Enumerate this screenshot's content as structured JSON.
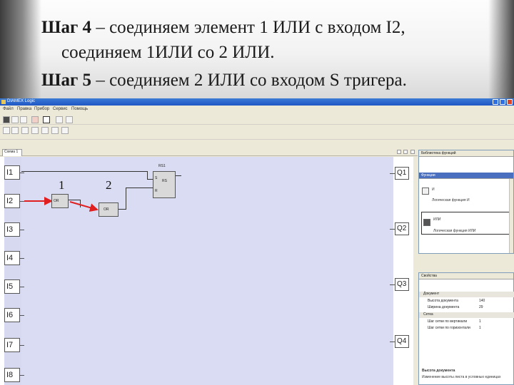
{
  "slide": {
    "line1_bold": "Шаг 4",
    "line1_text": " – соединяем элемент 1 ИЛИ с входом I2,",
    "line2_text": "соединяем 1ИЛИ со 2 ИЛИ.",
    "line3_bold": "Шаг 5",
    "line3_text": " – соединяем 2 ИЛИ со входом S тригера."
  },
  "app": {
    "title": "DIAMEX Logic",
    "menu": [
      "Файл",
      "Правка",
      "Прибор",
      "Сервис",
      "Помощь"
    ],
    "tab_label": "Схема 1",
    "inputs": [
      "I1",
      "I2",
      "I3",
      "I4",
      "I5",
      "I6",
      "I7",
      "I8"
    ],
    "outputs": [
      "Q1",
      "Q2",
      "Q3",
      "Q4"
    ],
    "blocks": {
      "or1_label": "OR",
      "or2_label": "OR",
      "trigger_label": "RS",
      "trigger_tag": "RS1",
      "trigger_pin_s": "S",
      "trigger_pin_r": "R",
      "num1": "1",
      "num2": "2"
    },
    "panels": {
      "library": {
        "title": "Библиотека функций",
        "header": "Функции",
        "item1_name": "И",
        "item1_desc": "Логическая функция И",
        "item2_name": "ИЛИ",
        "item2_desc": "Логическая функция ИЛИ"
      },
      "properties": {
        "title": "Свойства",
        "cat1": "Документ",
        "row1_key": "Высота документа",
        "row1_val": "140",
        "row2_key": "Ширина документа",
        "row2_val": "29",
        "cat2": "Сетка",
        "row3_key": "Шаг сетки по вертикали",
        "row3_val": "1",
        "row4_key": "Шаг сетки по горизонтали",
        "row4_val": "1",
        "footer_title": "Высота документа",
        "footer_desc": "Изменение высоты листа в условных единицах"
      }
    }
  },
  "colors": {
    "canvas_bg": "#d9dcf3",
    "highlight_arrow": "#e02020",
    "title_bar": "#1f56c4"
  }
}
